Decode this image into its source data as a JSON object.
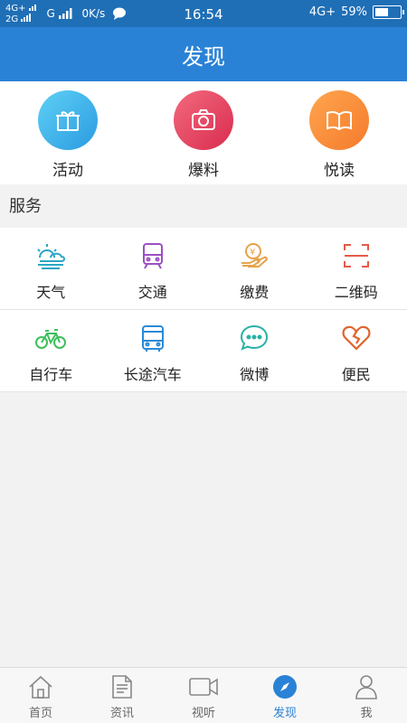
{
  "status_bar": {
    "network_top": "4G+",
    "network_bottom": "2G",
    "signal2": "G",
    "speed": "0K/s",
    "time": "16:54",
    "network_right": "4G+",
    "battery": "59%",
    "battery_level": 0.59
  },
  "header": {
    "title": "发现"
  },
  "top_items": [
    {
      "label": "活动",
      "icon": "gift-icon",
      "color": "#3cb4e8"
    },
    {
      "label": "爆料",
      "icon": "camera-icon",
      "color": "#e5405e"
    },
    {
      "label": "悦读",
      "icon": "book-icon",
      "color": "#f5893a"
    }
  ],
  "services": {
    "title": "服务",
    "items": [
      {
        "label": "天气",
        "icon": "weather-icon",
        "color": "#2aa7c4"
      },
      {
        "label": "交通",
        "icon": "train-icon",
        "color": "#9b4fc4"
      },
      {
        "label": "缴费",
        "icon": "payment-icon",
        "color": "#e6a24a"
      },
      {
        "label": "二维码",
        "icon": "qr-scan-icon",
        "color": "#e65a4a"
      },
      {
        "label": "自行车",
        "icon": "bicycle-icon",
        "color": "#3dbf5a"
      },
      {
        "label": "长途汽车",
        "icon": "bus-icon",
        "color": "#2a8ad6"
      },
      {
        "label": "微博",
        "icon": "chat-icon",
        "color": "#27b2a6"
      },
      {
        "label": "便民",
        "icon": "heart-icon",
        "color": "#e0642c"
      }
    ]
  },
  "tabs": [
    {
      "label": "首页",
      "icon": "home-icon",
      "active": false
    },
    {
      "label": "资讯",
      "icon": "news-icon",
      "active": false
    },
    {
      "label": "视听",
      "icon": "video-icon",
      "active": false
    },
    {
      "label": "发现",
      "icon": "compass-icon",
      "active": true
    },
    {
      "label": "我",
      "icon": "user-icon",
      "active": false
    }
  ],
  "colors": {
    "header": "#2a82d6",
    "status_bar": "#1f6fb6",
    "active_tab": "#2a82d6"
  }
}
